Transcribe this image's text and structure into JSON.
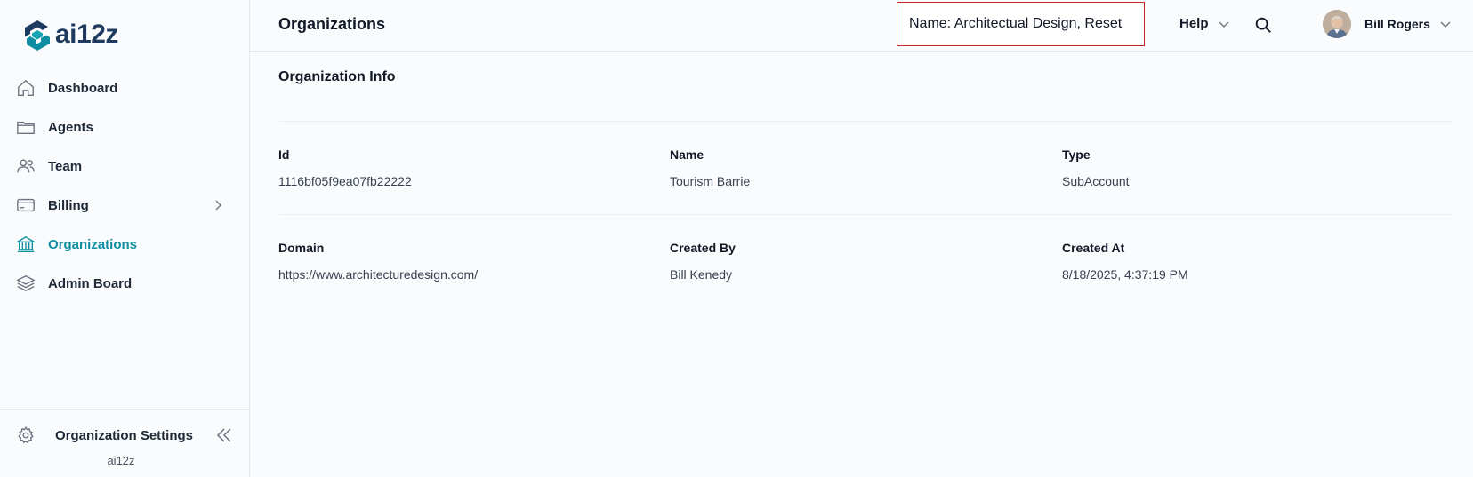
{
  "brand": {
    "name": "ai12z",
    "accent": "#0e8ea0",
    "logo_color": "#1e3a5f"
  },
  "sidebar": {
    "items": [
      {
        "label": "Dashboard",
        "icon": "home-icon",
        "active": false
      },
      {
        "label": "Agents",
        "icon": "folder-icon",
        "active": false
      },
      {
        "label": "Team",
        "icon": "users-icon",
        "active": false
      },
      {
        "label": "Billing",
        "icon": "credit-card-icon",
        "active": false,
        "has_submenu": true
      },
      {
        "label": "Organizations",
        "icon": "bank-icon",
        "active": true
      },
      {
        "label": "Admin Board",
        "icon": "layers-icon",
        "active": false
      }
    ],
    "footer": {
      "label": "Organization Settings",
      "icon": "gear-icon",
      "org": "ai12z"
    }
  },
  "header": {
    "title": "Organizations",
    "filter_text": "Name: Architectual Design, Reset",
    "help_label": "Help",
    "user_name": "Bill Rogers"
  },
  "main": {
    "section_title": "Organization Info",
    "fields": {
      "id": {
        "label": "Id",
        "value": "1116bf05f9ea07fb22222"
      },
      "name": {
        "label": "Name",
        "value": "Tourism Barrie"
      },
      "type": {
        "label": "Type",
        "value": "SubAccount"
      },
      "domain": {
        "label": "Domain",
        "value": "https://www.architecturedesign.com/"
      },
      "created_by": {
        "label": "Created By",
        "value": "Bill Kenedy"
      },
      "created_at": {
        "label": "Created At",
        "value": "8/18/2025, 4:37:19 PM"
      }
    }
  }
}
